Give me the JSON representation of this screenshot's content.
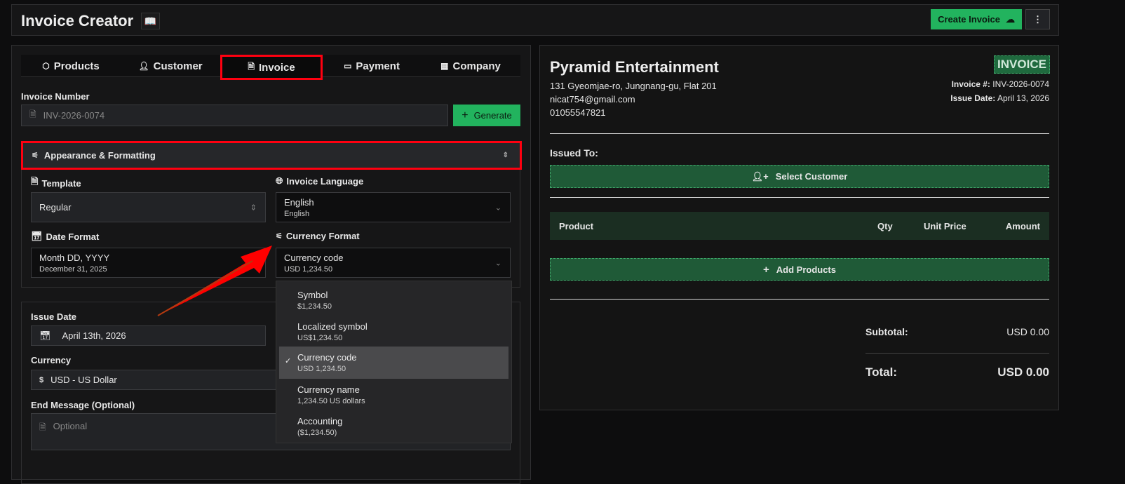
{
  "header": {
    "title": "Invoice Creator",
    "create_label": "Create Invoice",
    "more_label": "⋮"
  },
  "tabs": [
    {
      "label": "Products",
      "icon": "box-icon"
    },
    {
      "label": "Customer",
      "icon": "user-icon"
    },
    {
      "label": "Invoice",
      "icon": "document-icon"
    },
    {
      "label": "Payment",
      "icon": "card-icon"
    },
    {
      "label": "Company",
      "icon": "building-icon"
    }
  ],
  "form": {
    "invoice_number_label": "Invoice Number",
    "invoice_number_placeholder": "INV-2026-0074",
    "generate_label": "Generate",
    "appearance_label": "Appearance & Formatting",
    "template_label": "Template",
    "template_value": "Regular",
    "language_label": "Invoice Language",
    "language_value": "English",
    "language_sub": "English",
    "date_format_label": "Date Format",
    "date_format_value": "Month DD, YYYY",
    "date_format_sub": "December 31, 2025",
    "currency_format_label": "Currency Format",
    "currency_format_value": "Currency code",
    "currency_format_sub": "USD 1,234.50",
    "issue_date_label": "Issue Date",
    "issue_date_value": "April 13th, 2026",
    "currency_label": "Currency",
    "currency_symbol": "$",
    "currency_value": "USD - US Dollar",
    "end_message_label": "End Message (Optional)",
    "end_message_placeholder": "Optional"
  },
  "currency_options": [
    {
      "label": "Symbol",
      "example": "$1,234.50",
      "selected": false
    },
    {
      "label": "Localized symbol",
      "example": "US$1,234.50",
      "selected": false
    },
    {
      "label": "Currency code",
      "example": "USD 1,234.50",
      "selected": true
    },
    {
      "label": "Currency name",
      "example": "1,234.50 US dollars",
      "selected": false
    },
    {
      "label": "Accounting",
      "example": "($1,234.50)",
      "selected": false
    }
  ],
  "preview": {
    "company": "Pyramid Entertainment",
    "address": "131 Gyeomjae-ro, Jungnang-gu, Flat 201",
    "email": "nicat754@gmail.com",
    "phone": "01055547821",
    "badge": "INVOICE",
    "invoice_no_label": "Invoice #:",
    "invoice_no": "INV-2026-0074",
    "issue_date_label": "Issue Date:",
    "issue_date": "April 13, 2026",
    "issued_to": "Issued To:",
    "select_customer": "Select Customer",
    "columns": [
      "Product",
      "Qty",
      "Unit Price",
      "Amount"
    ],
    "add_products": "Add Products",
    "subtotal_label": "Subtotal:",
    "subtotal": "USD 0.00",
    "total_label": "Total:",
    "total": "USD 0.00"
  },
  "colors": {
    "accent": "#22b35e",
    "annotation": "#ff0000"
  }
}
